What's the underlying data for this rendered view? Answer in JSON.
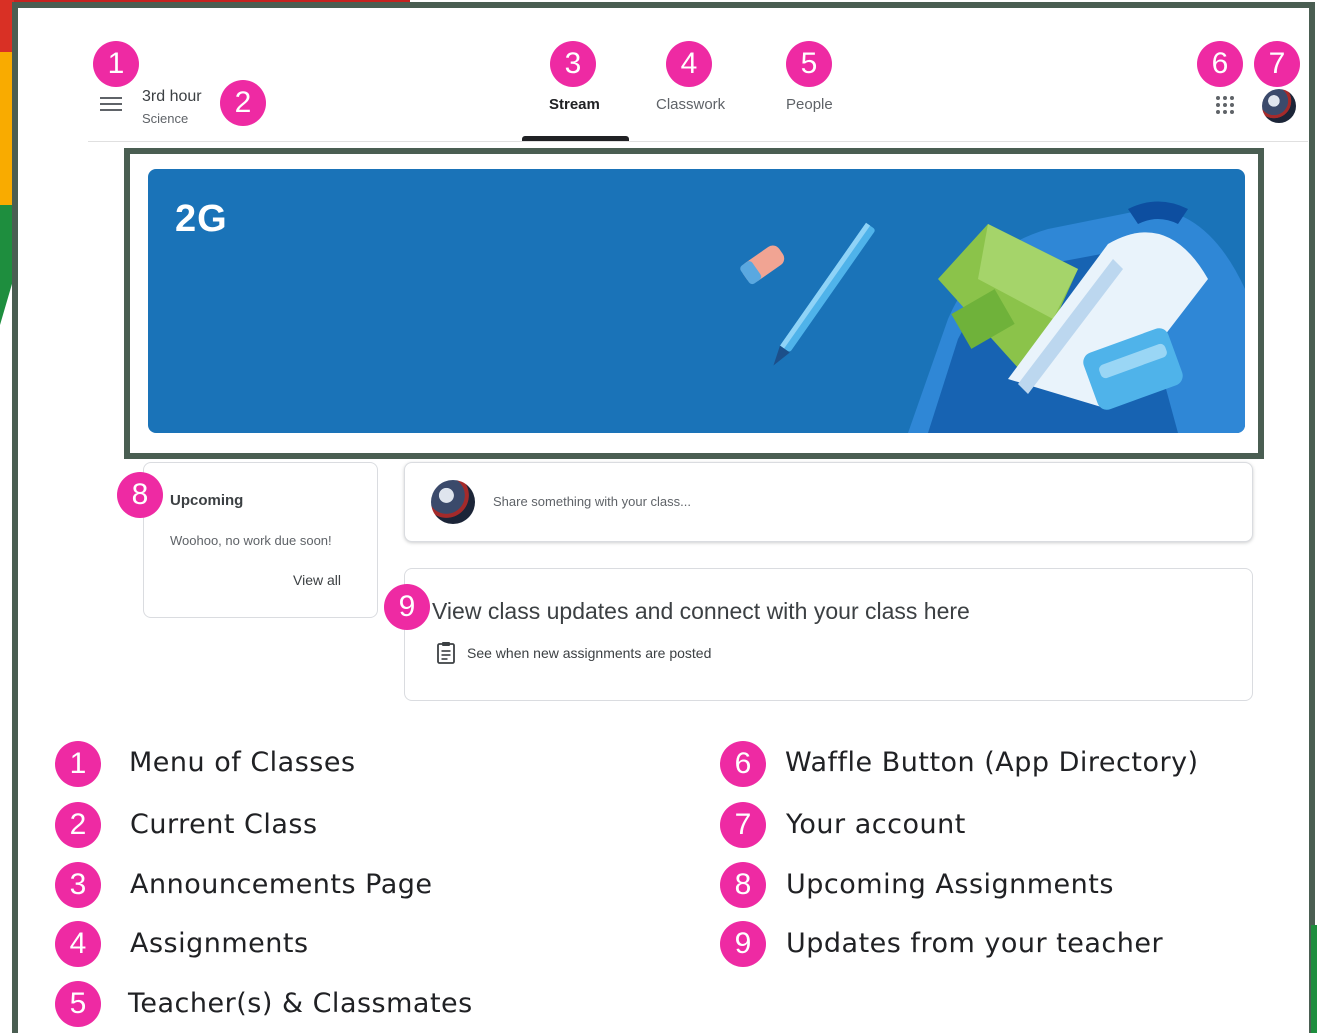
{
  "header": {
    "class_title": "3rd hour",
    "class_subtitle": "Science",
    "tabs": [
      {
        "label": "Stream",
        "active": true
      },
      {
        "label": "Classwork",
        "active": false
      },
      {
        "label": "People",
        "active": false
      }
    ],
    "icons": {
      "menu": "hamburger-menu-icon",
      "apps": "waffle-grid-icon",
      "account": "user-avatar"
    }
  },
  "banner": {
    "title": "2G",
    "color": "#1a73b8"
  },
  "upcoming": {
    "title": "Upcoming",
    "empty_text": "Woohoo, no work due soon!",
    "link": "View all"
  },
  "share": {
    "placeholder": "Share something with your class..."
  },
  "updates": {
    "title": "View class updates and connect with your class here",
    "subtitle": "See when new assignments are posted",
    "icon": "clipboard-icon"
  },
  "badges": [
    "1",
    "2",
    "3",
    "4",
    "5",
    "6",
    "7",
    "8",
    "9"
  ],
  "legend": [
    {
      "number": "1",
      "label": "Menu of Classes"
    },
    {
      "number": "2",
      "label": "Current Class"
    },
    {
      "number": "3",
      "label": "Announcements Page"
    },
    {
      "number": "4",
      "label": "Assignments"
    },
    {
      "number": "5",
      "label": "Teacher(s) & Classmates"
    },
    {
      "number": "6",
      "label": "Waffle Button (App Directory)"
    },
    {
      "number": "7",
      "label": "Your account"
    },
    {
      "number": "8",
      "label": "Upcoming Assignments"
    },
    {
      "number": "9",
      "label": "Updates from your teacher"
    }
  ],
  "colors": {
    "badge": "#ee2aa3",
    "frame": "#4a5e52"
  }
}
